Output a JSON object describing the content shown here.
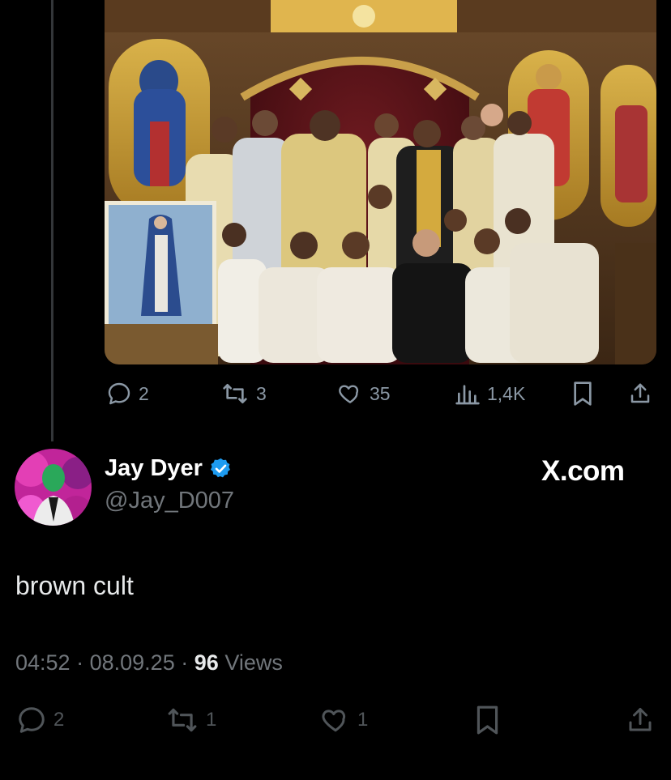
{
  "quoted_post": {
    "stats": {
      "replies": "2",
      "reposts": "3",
      "likes": "35",
      "views": "1,4K"
    }
  },
  "post": {
    "author_name": "Jay Dyer",
    "author_handle": "@Jay_D007",
    "brand": "X.com",
    "text": "brown cult",
    "time": "04:52",
    "date": "08.09.25",
    "separator": "·",
    "views_count": "96",
    "views_label": "Views",
    "stats": {
      "replies": "2",
      "reposts": "1",
      "likes": "1"
    }
  },
  "icons": [
    "reply-icon",
    "repost-icon",
    "like-icon",
    "views-icon",
    "bookmark-icon",
    "share-icon",
    "verified-badge-icon"
  ],
  "colors": {
    "background": "#000000",
    "verified": "#1d9bf0",
    "muted": "#71767b",
    "text": "#e7e9ea"
  }
}
